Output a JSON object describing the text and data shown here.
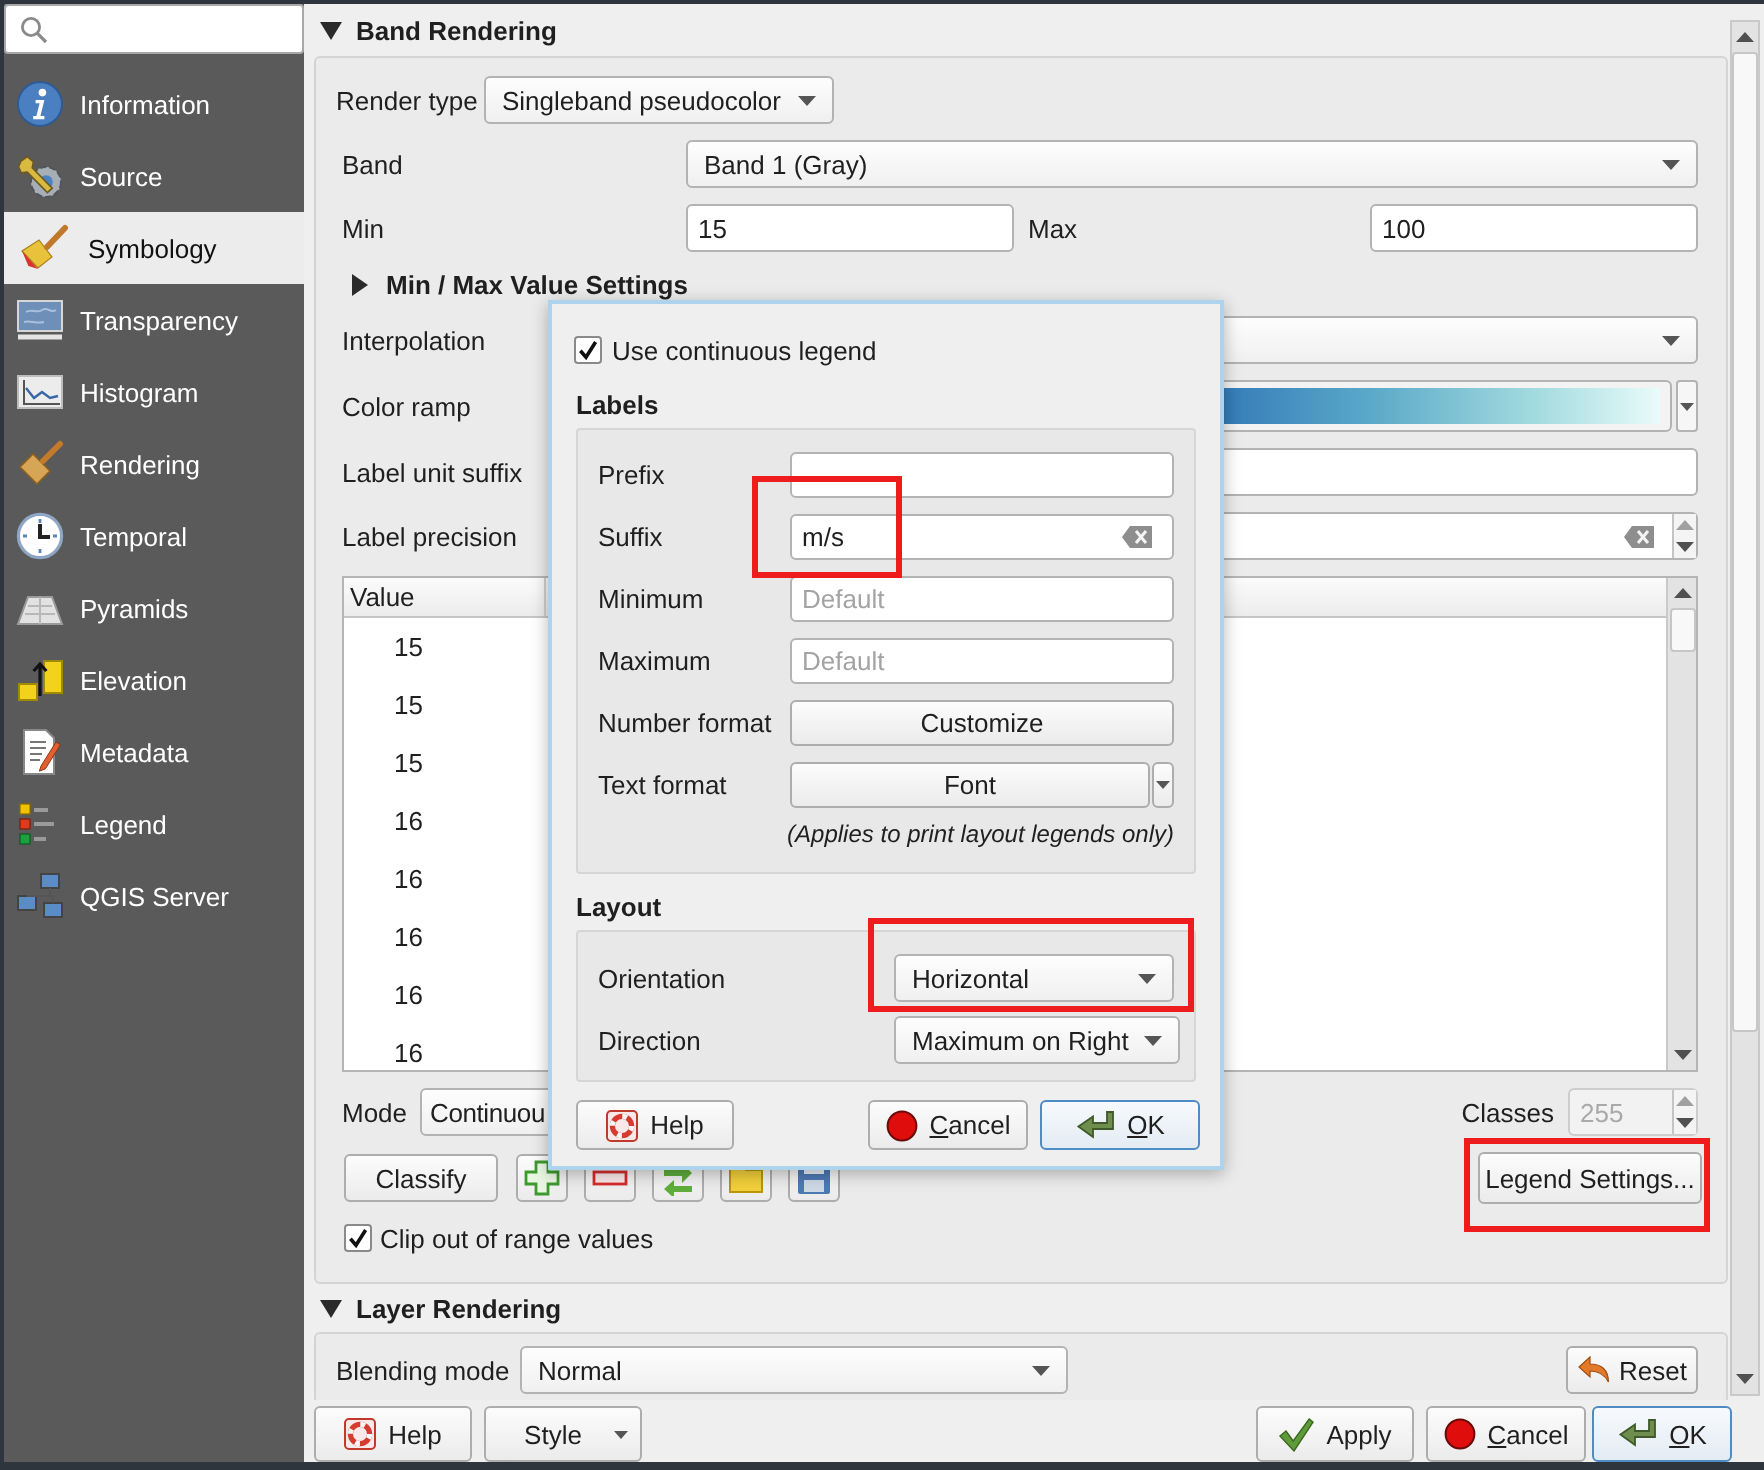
{
  "sidebar": {
    "items": [
      {
        "label": "Information",
        "selected": false
      },
      {
        "label": "Source",
        "selected": false
      },
      {
        "label": "Symbology",
        "selected": true
      },
      {
        "label": "Transparency",
        "selected": false
      },
      {
        "label": "Histogram",
        "selected": false
      },
      {
        "label": "Rendering",
        "selected": false
      },
      {
        "label": "Temporal",
        "selected": false
      },
      {
        "label": "Pyramids",
        "selected": false
      },
      {
        "label": "Elevation",
        "selected": false
      },
      {
        "label": "Metadata",
        "selected": false
      },
      {
        "label": "Legend",
        "selected": false
      },
      {
        "label": "QGIS Server",
        "selected": false
      }
    ]
  },
  "band_rendering": {
    "title": "Band Rendering",
    "expanded": true,
    "render_type": {
      "label": "Render type",
      "value": "Singleband pseudocolor"
    },
    "band": {
      "label": "Band",
      "value": "Band 1 (Gray)"
    },
    "min": {
      "label": "Min",
      "value": "15"
    },
    "max": {
      "label": "Max",
      "value": "100"
    },
    "min_max_settings": {
      "title": "Min / Max Value Settings",
      "expanded": false
    },
    "interpolation": {
      "label": "Interpolation"
    },
    "color_ramp": {
      "label": "Color ramp"
    },
    "label_unit_suffix": {
      "label": "Label unit suffix"
    },
    "label_precision": {
      "label": "Label precision"
    },
    "table": {
      "columns": [
        "Value"
      ],
      "rows": [
        {
          "value": "15"
        },
        {
          "value": "15"
        },
        {
          "value": "15"
        },
        {
          "value": "16"
        },
        {
          "value": "16"
        },
        {
          "value": "16"
        },
        {
          "value": "16"
        },
        {
          "value": "16"
        }
      ]
    },
    "mode": {
      "label": "Mode",
      "value": "Continuou"
    },
    "classes": {
      "label": "Classes",
      "value": "255",
      "disabled": true
    },
    "classify_button": "Classify",
    "legend_settings_button": {
      "label": "Legend Settings...",
      "highlighted": true
    },
    "clip": {
      "label": "Clip out of range values",
      "checked": true
    }
  },
  "layer_rendering": {
    "title": "Layer Rendering",
    "expanded": true,
    "blending_mode": {
      "label": "Blending mode",
      "value": "Normal"
    },
    "reset_button": "Reset"
  },
  "buttons": [
    {
      "label": "Help",
      "kind": "help",
      "default": false,
      "mnemonic": false
    },
    {
      "label": "Style",
      "kind": "menu",
      "default": false,
      "mnemonic": false
    },
    {
      "label": "Apply",
      "kind": "apply",
      "default": false,
      "mnemonic": false
    },
    {
      "label": "Cancel",
      "kind": "cancel",
      "default": false,
      "mnemonic": true
    },
    {
      "label": "OK",
      "kind": "ok",
      "default": true,
      "mnemonic": true
    }
  ],
  "legend_dialog": {
    "continuous_legend": {
      "label": "Use continuous legend",
      "checked": true
    },
    "labels": {
      "title": "Labels",
      "fields": [
        {
          "label": "Prefix",
          "kind": "text",
          "highlighted": false
        },
        {
          "label": "Suffix",
          "kind": "text",
          "value": "m/s",
          "highlighted": true
        },
        {
          "label": "Minimum",
          "kind": "text",
          "placeholder": "Default",
          "highlighted": false
        },
        {
          "label": "Maximum",
          "kind": "text",
          "placeholder": "Default",
          "highlighted": false
        },
        {
          "label": "Number format",
          "kind": "button",
          "value": "Customize",
          "highlighted": false
        },
        {
          "label": "Text format",
          "kind": "menu_button",
          "value": "Font",
          "highlighted": false
        }
      ],
      "note": "(Applies to print layout legends only)"
    },
    "layout": {
      "title": "Layout",
      "fields": [
        {
          "label": "Orientation",
          "value": "Horizontal",
          "highlighted": true
        },
        {
          "label": "Direction",
          "value": "Maximum on Right",
          "highlighted": false
        }
      ]
    },
    "buttons": [
      {
        "label": "Help",
        "kind": "help",
        "default": false,
        "mnemonic": false
      },
      {
        "label": "Cancel",
        "kind": "cancel",
        "default": false,
        "mnemonic": true
      },
      {
        "label": "OK",
        "kind": "ok",
        "default": true,
        "mnemonic": true
      }
    ]
  }
}
